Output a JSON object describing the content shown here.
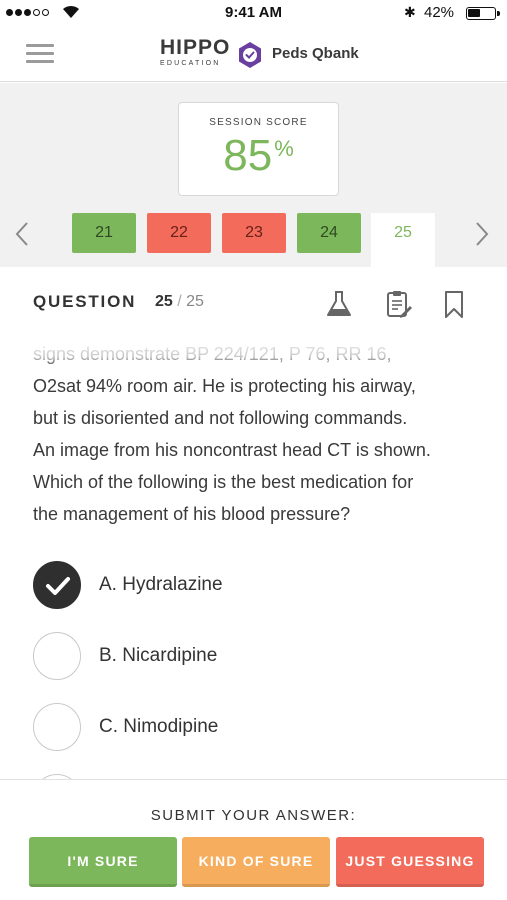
{
  "status_bar": {
    "time": "9:41 AM",
    "battery": "42%"
  },
  "nav": {
    "logo_main": "HIPPO",
    "logo_sub": "EDUCATION",
    "product": "Peds Qbank"
  },
  "session": {
    "label": "SESSION SCORE",
    "score": "85",
    "unit": "%"
  },
  "question_tabs": [
    {
      "number": "21",
      "status": "correct"
    },
    {
      "number": "22",
      "status": "incorrect"
    },
    {
      "number": "23",
      "status": "incorrect"
    },
    {
      "number": "24",
      "status": "correct"
    },
    {
      "number": "25",
      "status": "current"
    }
  ],
  "question": {
    "header": "QUESTION",
    "current": "25",
    "separator": "/",
    "total": "25",
    "text_lines": [
      "signs demonstrate BP 224/121, P 76, RR 16,",
      "O2sat 94% room air. He is protecting his airway,",
      "but is disoriented and not following commands.",
      "An image from his noncontrast head CT is shown.",
      "Which of the following is the best medication for",
      "the management of his blood pressure?"
    ],
    "tools": [
      "lab-values-icon",
      "notes-icon",
      "bookmark-icon"
    ]
  },
  "options": [
    {
      "label": "A. Hydralazine",
      "selected": true
    },
    {
      "label": "B. Nicardipine",
      "selected": false
    },
    {
      "label": "C. Nimodipine",
      "selected": false
    }
  ],
  "submit": {
    "title": "SUBMIT YOUR ANSWER:",
    "sure": "I'M SURE",
    "kind_of_sure": "KIND OF SURE",
    "guessing": "JUST GUESSING"
  },
  "colors": {
    "correct": "#7cb75b",
    "incorrect": "#f26b5b",
    "sure": "#7cb75b",
    "kind_of_sure": "#f6ad5e",
    "guessing": "#f26b5b",
    "brand_purple": "#6a3fa0"
  }
}
